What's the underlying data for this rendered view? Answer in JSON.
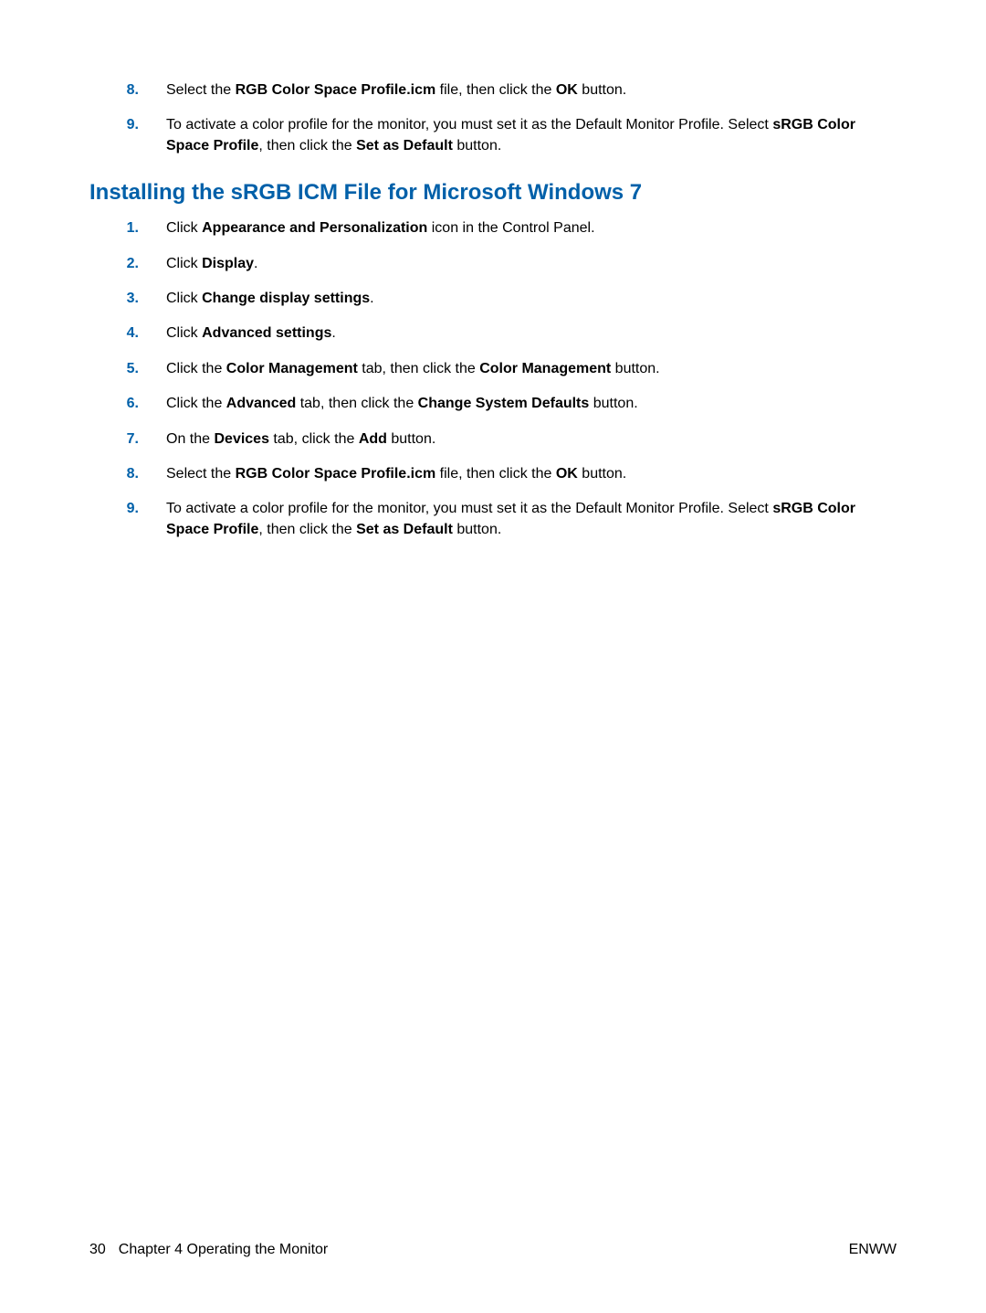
{
  "colors": {
    "accent": "#0060a9"
  },
  "topList": {
    "items": [
      {
        "n": "8.",
        "segments": [
          {
            "t": "Select the "
          },
          {
            "t": "RGB Color Space Profile.icm",
            "b": true
          },
          {
            "t": " file, then click the "
          },
          {
            "t": "OK",
            "b": true
          },
          {
            "t": " button."
          }
        ]
      },
      {
        "n": "9.",
        "segments": [
          {
            "t": "To activate a color profile for the monitor, you must set it as the Default Monitor Profile. Select "
          },
          {
            "t": "sRGB Color Space Profile",
            "b": true
          },
          {
            "t": ", then click the "
          },
          {
            "t": "Set as Default",
            "b": true
          },
          {
            "t": " button."
          }
        ]
      }
    ]
  },
  "heading": "Installing the sRGB ICM File for Microsoft Windows 7",
  "mainList": {
    "items": [
      {
        "n": "1.",
        "segments": [
          {
            "t": "Click "
          },
          {
            "t": "Appearance and Personalization",
            "b": true
          },
          {
            "t": " icon in the Control Panel."
          }
        ]
      },
      {
        "n": "2.",
        "segments": [
          {
            "t": "Click "
          },
          {
            "t": "Display",
            "b": true
          },
          {
            "t": "."
          }
        ]
      },
      {
        "n": "3.",
        "segments": [
          {
            "t": "Click "
          },
          {
            "t": "Change display settings",
            "b": true
          },
          {
            "t": "."
          }
        ]
      },
      {
        "n": "4.",
        "segments": [
          {
            "t": "Click "
          },
          {
            "t": "Advanced settings",
            "b": true
          },
          {
            "t": "."
          }
        ]
      },
      {
        "n": "5.",
        "segments": [
          {
            "t": "Click the "
          },
          {
            "t": "Color Management",
            "b": true
          },
          {
            "t": " tab, then click the "
          },
          {
            "t": "Color Management",
            "b": true
          },
          {
            "t": " button."
          }
        ]
      },
      {
        "n": "6.",
        "segments": [
          {
            "t": "Click the "
          },
          {
            "t": "Advanced",
            "b": true
          },
          {
            "t": " tab, then click the "
          },
          {
            "t": "Change System Defaults",
            "b": true
          },
          {
            "t": " button."
          }
        ]
      },
      {
        "n": "7.",
        "segments": [
          {
            "t": "On the "
          },
          {
            "t": "Devices",
            "b": true
          },
          {
            "t": " tab, click the "
          },
          {
            "t": "Add",
            "b": true
          },
          {
            "t": " button."
          }
        ]
      },
      {
        "n": "8.",
        "segments": [
          {
            "t": "Select the "
          },
          {
            "t": "RGB Color Space Profile.icm",
            "b": true
          },
          {
            "t": " file, then click the "
          },
          {
            "t": "OK",
            "b": true
          },
          {
            "t": " button."
          }
        ]
      },
      {
        "n": "9.",
        "segments": [
          {
            "t": "To activate a color profile for the monitor, you must set it as the Default Monitor Profile. Select "
          },
          {
            "t": "sRGB Color Space Profile",
            "b": true
          },
          {
            "t": ", then click the "
          },
          {
            "t": "Set as Default",
            "b": true
          },
          {
            "t": " button."
          }
        ]
      }
    ]
  },
  "footer": {
    "pageNumber": "30",
    "chapterLabel": "Chapter 4   Operating the Monitor",
    "right": "ENWW"
  }
}
